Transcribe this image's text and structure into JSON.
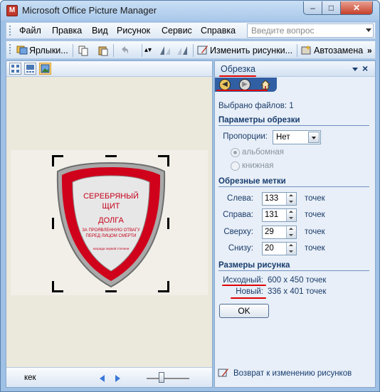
{
  "window": {
    "title": "Microsoft Office Picture Manager",
    "min": "–",
    "max": "□",
    "close": "✕"
  },
  "menu": {
    "items": [
      "Файл",
      "Правка",
      "Вид",
      "Рисунок",
      "Сервис",
      "Справка"
    ],
    "help_placeholder": "Введите вопрос"
  },
  "toolbar": {
    "shortcuts": "Ярлыки...",
    "edit_pictures": "Изменить рисунки...",
    "autocorrect": "Автозамена",
    "more": "»"
  },
  "view": {
    "thumbnails": "thumbnails-view",
    "filmstrip": "filmstrip-view",
    "single": "single-picture-view"
  },
  "status": {
    "file_name": "кек"
  },
  "image": {
    "line1": "СЕРЕБРЯНЫЙ",
    "line2": "ЩИТ",
    "line3": "ДОЛГА",
    "line4": "ЗА ПРОЯВЛЕННУЮ ОТВАГУ",
    "line5": "ПЕРЕД ЛИЦОМ СМЕРТИ",
    "line6": "награда первой степени"
  },
  "task_pane": {
    "title": "Обрезка",
    "selected_files": "Выбрано файлов: 1",
    "crop_params_title": "Параметры обрезки",
    "proportions_label": "Пропорции:",
    "proportions_value": "Нет",
    "landscape": "альбомная",
    "portrait": "книжная",
    "crop_marks_title": "Обрезные метки",
    "fields": [
      {
        "label": "Слева:",
        "value": "133",
        "unit": "точек"
      },
      {
        "label": "Справа:",
        "value": "131",
        "unit": "точек"
      },
      {
        "label": "Сверху:",
        "value": "29",
        "unit": "точек"
      },
      {
        "label": "Снизу:",
        "value": "20",
        "unit": "точек"
      }
    ],
    "size_title": "Размеры рисунка",
    "original_label": "Исходный:",
    "original_value": "600 x 450 точек",
    "new_label": "Новый:",
    "new_value": "336 x 401 точек",
    "ok": "OK",
    "footer_link": "Возврат к изменению рисунков"
  }
}
